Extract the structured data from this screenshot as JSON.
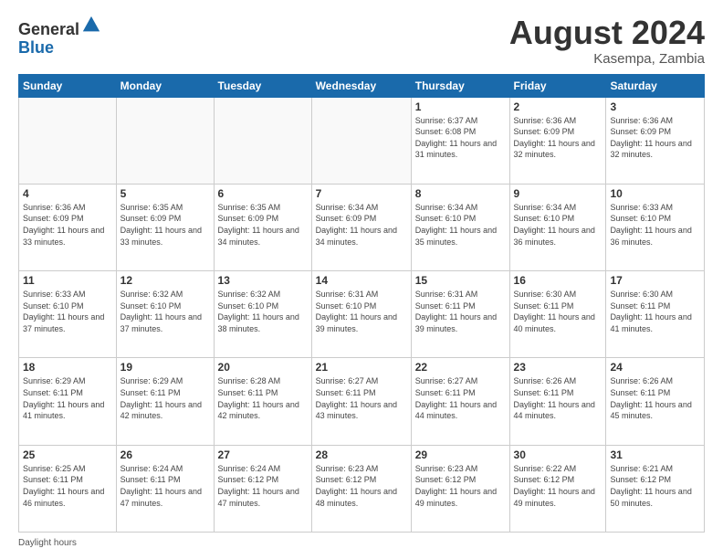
{
  "header": {
    "logo_line1": "General",
    "logo_line2": "Blue",
    "month": "August 2024",
    "location": "Kasempa, Zambia"
  },
  "weekdays": [
    "Sunday",
    "Monday",
    "Tuesday",
    "Wednesday",
    "Thursday",
    "Friday",
    "Saturday"
  ],
  "weeks": [
    [
      {
        "day": "",
        "info": ""
      },
      {
        "day": "",
        "info": ""
      },
      {
        "day": "",
        "info": ""
      },
      {
        "day": "",
        "info": ""
      },
      {
        "day": "1",
        "info": "Sunrise: 6:37 AM\nSunset: 6:08 PM\nDaylight: 11 hours and 31 minutes."
      },
      {
        "day": "2",
        "info": "Sunrise: 6:36 AM\nSunset: 6:09 PM\nDaylight: 11 hours and 32 minutes."
      },
      {
        "day": "3",
        "info": "Sunrise: 6:36 AM\nSunset: 6:09 PM\nDaylight: 11 hours and 32 minutes."
      }
    ],
    [
      {
        "day": "4",
        "info": "Sunrise: 6:36 AM\nSunset: 6:09 PM\nDaylight: 11 hours and 33 minutes."
      },
      {
        "day": "5",
        "info": "Sunrise: 6:35 AM\nSunset: 6:09 PM\nDaylight: 11 hours and 33 minutes."
      },
      {
        "day": "6",
        "info": "Sunrise: 6:35 AM\nSunset: 6:09 PM\nDaylight: 11 hours and 34 minutes."
      },
      {
        "day": "7",
        "info": "Sunrise: 6:34 AM\nSunset: 6:09 PM\nDaylight: 11 hours and 34 minutes."
      },
      {
        "day": "8",
        "info": "Sunrise: 6:34 AM\nSunset: 6:10 PM\nDaylight: 11 hours and 35 minutes."
      },
      {
        "day": "9",
        "info": "Sunrise: 6:34 AM\nSunset: 6:10 PM\nDaylight: 11 hours and 36 minutes."
      },
      {
        "day": "10",
        "info": "Sunrise: 6:33 AM\nSunset: 6:10 PM\nDaylight: 11 hours and 36 minutes."
      }
    ],
    [
      {
        "day": "11",
        "info": "Sunrise: 6:33 AM\nSunset: 6:10 PM\nDaylight: 11 hours and 37 minutes."
      },
      {
        "day": "12",
        "info": "Sunrise: 6:32 AM\nSunset: 6:10 PM\nDaylight: 11 hours and 37 minutes."
      },
      {
        "day": "13",
        "info": "Sunrise: 6:32 AM\nSunset: 6:10 PM\nDaylight: 11 hours and 38 minutes."
      },
      {
        "day": "14",
        "info": "Sunrise: 6:31 AM\nSunset: 6:10 PM\nDaylight: 11 hours and 39 minutes."
      },
      {
        "day": "15",
        "info": "Sunrise: 6:31 AM\nSunset: 6:11 PM\nDaylight: 11 hours and 39 minutes."
      },
      {
        "day": "16",
        "info": "Sunrise: 6:30 AM\nSunset: 6:11 PM\nDaylight: 11 hours and 40 minutes."
      },
      {
        "day": "17",
        "info": "Sunrise: 6:30 AM\nSunset: 6:11 PM\nDaylight: 11 hours and 41 minutes."
      }
    ],
    [
      {
        "day": "18",
        "info": "Sunrise: 6:29 AM\nSunset: 6:11 PM\nDaylight: 11 hours and 41 minutes."
      },
      {
        "day": "19",
        "info": "Sunrise: 6:29 AM\nSunset: 6:11 PM\nDaylight: 11 hours and 42 minutes."
      },
      {
        "day": "20",
        "info": "Sunrise: 6:28 AM\nSunset: 6:11 PM\nDaylight: 11 hours and 42 minutes."
      },
      {
        "day": "21",
        "info": "Sunrise: 6:27 AM\nSunset: 6:11 PM\nDaylight: 11 hours and 43 minutes."
      },
      {
        "day": "22",
        "info": "Sunrise: 6:27 AM\nSunset: 6:11 PM\nDaylight: 11 hours and 44 minutes."
      },
      {
        "day": "23",
        "info": "Sunrise: 6:26 AM\nSunset: 6:11 PM\nDaylight: 11 hours and 44 minutes."
      },
      {
        "day": "24",
        "info": "Sunrise: 6:26 AM\nSunset: 6:11 PM\nDaylight: 11 hours and 45 minutes."
      }
    ],
    [
      {
        "day": "25",
        "info": "Sunrise: 6:25 AM\nSunset: 6:11 PM\nDaylight: 11 hours and 46 minutes."
      },
      {
        "day": "26",
        "info": "Sunrise: 6:24 AM\nSunset: 6:11 PM\nDaylight: 11 hours and 47 minutes."
      },
      {
        "day": "27",
        "info": "Sunrise: 6:24 AM\nSunset: 6:12 PM\nDaylight: 11 hours and 47 minutes."
      },
      {
        "day": "28",
        "info": "Sunrise: 6:23 AM\nSunset: 6:12 PM\nDaylight: 11 hours and 48 minutes."
      },
      {
        "day": "29",
        "info": "Sunrise: 6:23 AM\nSunset: 6:12 PM\nDaylight: 11 hours and 49 minutes."
      },
      {
        "day": "30",
        "info": "Sunrise: 6:22 AM\nSunset: 6:12 PM\nDaylight: 11 hours and 49 minutes."
      },
      {
        "day": "31",
        "info": "Sunrise: 6:21 AM\nSunset: 6:12 PM\nDaylight: 11 hours and 50 minutes."
      }
    ]
  ],
  "footer": {
    "label": "Daylight hours"
  }
}
